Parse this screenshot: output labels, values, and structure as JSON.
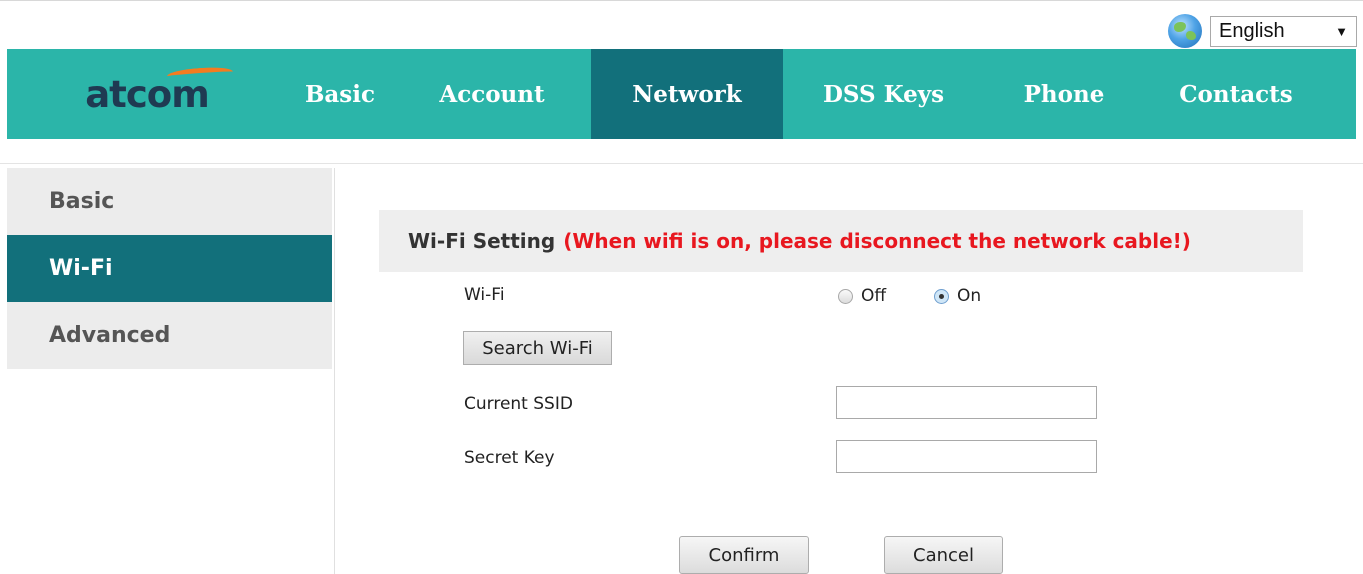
{
  "language": {
    "selected": "English"
  },
  "brand": {
    "logo_text": "atcom"
  },
  "nav": {
    "items": [
      {
        "label": "Basic"
      },
      {
        "label": "Account"
      },
      {
        "label": "Network"
      },
      {
        "label": "DSS Keys"
      },
      {
        "label": "Phone"
      },
      {
        "label": "Contacts"
      }
    ],
    "active": "Network"
  },
  "sidebar": {
    "items": [
      {
        "label": "Basic"
      },
      {
        "label": "Wi-Fi"
      },
      {
        "label": "Advanced"
      }
    ],
    "active": "Wi-Fi"
  },
  "panel": {
    "title": "Wi-Fi Setting",
    "warning": "(When wifi is on, please disconnect the network cable!)"
  },
  "form": {
    "wifi_label": "Wi-Fi",
    "off_label": "Off",
    "on_label": "On",
    "wifi_state": "On",
    "search_button": "Search Wi-Fi",
    "ssid_label": "Current SSID",
    "ssid_value": "",
    "key_label": "Secret Key",
    "key_value": "",
    "confirm_button": "Confirm",
    "cancel_button": "Cancel"
  },
  "colors": {
    "nav_bg": "#2bb5a9",
    "active_bg": "#12707b",
    "warning": "#e8171f"
  }
}
